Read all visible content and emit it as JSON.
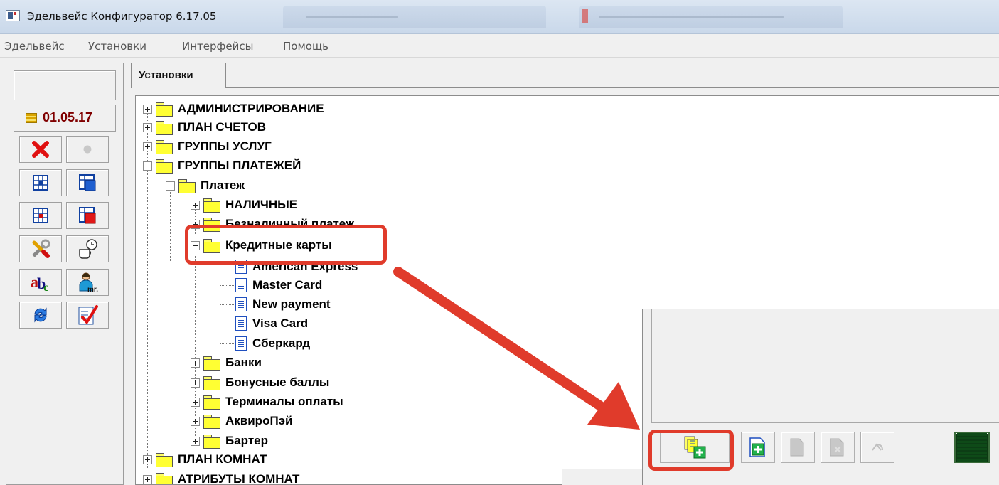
{
  "window": {
    "title": "Эдельвейс Конфигуратор 6.17.05"
  },
  "menu": {
    "items": [
      "Эдельвейс",
      "Установки",
      "Интерфейсы",
      "Помощь"
    ]
  },
  "sidebar": {
    "date": "01.05.17",
    "tools": [
      {
        "icon": "delete-icon",
        "enabled": true
      },
      {
        "icon": "record-icon",
        "enabled": false
      },
      {
        "icon": "grid-icon",
        "enabled": true
      },
      {
        "icon": "grid-open-icon",
        "enabled": true
      },
      {
        "icon": "grid-red-icon",
        "enabled": true
      },
      {
        "icon": "grid-red-open-icon",
        "enabled": true
      },
      {
        "icon": "tools-icon",
        "enabled": true
      },
      {
        "icon": "coffee-clock-icon",
        "enabled": true
      },
      {
        "icon": "abc-icon",
        "enabled": true
      },
      {
        "icon": "user-icon",
        "enabled": true
      },
      {
        "icon": "refresh-icon",
        "enabled": true
      },
      {
        "icon": "checklist-icon",
        "enabled": true
      }
    ]
  },
  "tabs": [
    {
      "label": "Установки",
      "active": true
    }
  ],
  "tree": {
    "nodes": [
      {
        "label": "АДМИНИСТРИРОВАНИЕ",
        "level": 0,
        "state": "collapsed",
        "type": "folder"
      },
      {
        "label": "ПЛАН СЧЕТОВ",
        "level": 0,
        "state": "collapsed",
        "type": "folder"
      },
      {
        "label": "ГРУППЫ УСЛУГ",
        "level": 0,
        "state": "collapsed",
        "type": "folder"
      },
      {
        "label": "ГРУППЫ ПЛАТЕЖЕЙ",
        "level": 0,
        "state": "expanded",
        "type": "folder"
      },
      {
        "label": "Платеж",
        "level": 1,
        "state": "expanded",
        "type": "folder"
      },
      {
        "label": "НАЛИЧНЫЕ",
        "level": 2,
        "state": "collapsed",
        "type": "folder"
      },
      {
        "label": "Безналичный платеж",
        "level": 2,
        "state": "collapsed",
        "type": "folder"
      },
      {
        "label": "Кредитные карты",
        "level": 2,
        "state": "expanded",
        "type": "folder-open"
      },
      {
        "label": "American Express",
        "level": 3,
        "type": "document"
      },
      {
        "label": "Master Card",
        "level": 3,
        "type": "document"
      },
      {
        "label": "New payment",
        "level": 3,
        "type": "document"
      },
      {
        "label": "Visa Card",
        "level": 3,
        "type": "document"
      },
      {
        "label": "Сберкард",
        "level": 3,
        "type": "document"
      },
      {
        "label": "Банки",
        "level": 2,
        "state": "collapsed",
        "type": "folder"
      },
      {
        "label": "Бонусные баллы",
        "level": 2,
        "state": "collapsed",
        "type": "folder"
      },
      {
        "label": "Терминалы оплаты",
        "level": 2,
        "state": "collapsed",
        "type": "folder"
      },
      {
        "label": "АквироПэй",
        "level": 2,
        "state": "collapsed",
        "type": "folder"
      },
      {
        "label": "Бартер",
        "level": 2,
        "state": "collapsed",
        "type": "folder"
      },
      {
        "label": "ПЛАН КОМНАТ",
        "level": 0,
        "state": "collapsed",
        "type": "folder"
      },
      {
        "label": "АТРИБУТЫ КОМНАТ",
        "level": 0,
        "state": "collapsed",
        "type": "folder"
      }
    ]
  },
  "toolbar": {
    "buttons": [
      {
        "icon": "add-child-folder-icon",
        "enabled": true,
        "highlighted": true
      },
      {
        "icon": "add-document-icon",
        "enabled": true
      },
      {
        "icon": "edit-document-icon",
        "enabled": false
      },
      {
        "icon": "delete-document-icon",
        "enabled": false
      },
      {
        "icon": "undo-icon",
        "enabled": false
      },
      {
        "icon": "status-indicator-icon",
        "enabled": true
      }
    ]
  },
  "colors": {
    "annotation": "#e03b2b",
    "date_text": "#800000",
    "folder": "#ffff33"
  }
}
